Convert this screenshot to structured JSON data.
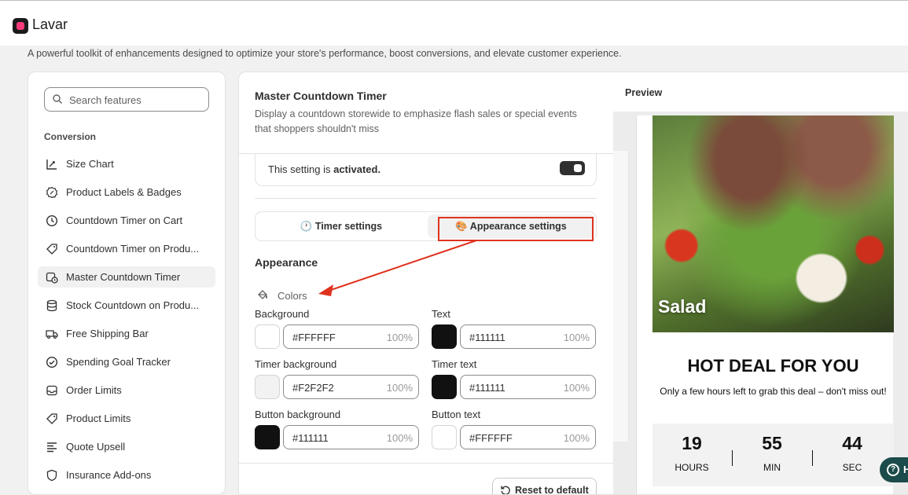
{
  "app": {
    "title": "Lavar",
    "tagline": "A powerful toolkit of enhancements designed to optimize your store's performance, boost conversions, and elevate customer experience."
  },
  "sidebar": {
    "search_placeholder": "Search features",
    "section": "Conversion",
    "items": [
      {
        "label": "Size Chart",
        "icon": "ruler-icon"
      },
      {
        "label": "Product Labels & Badges",
        "icon": "badge-icon"
      },
      {
        "label": "Countdown Timer on Cart",
        "icon": "clock-icon"
      },
      {
        "label": "Countdown Timer on Produ...",
        "icon": "tag-clock-icon"
      },
      {
        "label": "Master Countdown Timer",
        "icon": "calendar-clock-icon",
        "active": true
      },
      {
        "label": "Stock Countdown on Produ...",
        "icon": "database-icon"
      },
      {
        "label": "Free Shipping Bar",
        "icon": "truck-icon"
      },
      {
        "label": "Spending Goal Tracker",
        "icon": "check-circle-icon"
      },
      {
        "label": "Order Limits",
        "icon": "inbox-icon"
      },
      {
        "label": "Product Limits",
        "icon": "tag-icon"
      },
      {
        "label": "Quote Upsell",
        "icon": "list-icon"
      },
      {
        "label": "Insurance Add-ons",
        "icon": "shield-icon"
      }
    ]
  },
  "feature": {
    "title": "Master Countdown Timer",
    "description": "Display a countdown storewide to emphasize flash sales or special events that shoppers shouldn't miss",
    "activation_prefix": "This setting is ",
    "activation_state": "activated.",
    "tabs": [
      {
        "label": "🕐 Timer settings"
      },
      {
        "label": "🎨 Appearance settings",
        "selected": true
      }
    ],
    "appearance_heading": "Appearance",
    "colors_heading": "Colors",
    "colors": [
      {
        "label": "Background",
        "hex": "#FFFFFF",
        "opacity": "100%",
        "swatch": "#ffffff"
      },
      {
        "label": "Text",
        "hex": "#111111",
        "opacity": "100%",
        "swatch": "#111111"
      },
      {
        "label": "Timer background",
        "hex": "#F2F2F2",
        "opacity": "100%",
        "swatch": "#f2f2f2"
      },
      {
        "label": "Timer text",
        "hex": "#111111",
        "opacity": "100%",
        "swatch": "#111111"
      },
      {
        "label": "Button background",
        "hex": "#111111",
        "opacity": "100%",
        "swatch": "#111111"
      },
      {
        "label": "Button text",
        "hex": "#FFFFFF",
        "opacity": "100%",
        "swatch": "#ffffff"
      }
    ],
    "reset_label": "Reset to default"
  },
  "preview": {
    "heading": "Preview",
    "image_caption": "Salad",
    "deal_title": "HOT DEAL FOR YOU",
    "deal_subtitle": "Only a few hours left to grab this deal – don't miss out!",
    "timer": [
      {
        "value": "19",
        "unit": "HOURS"
      },
      {
        "value": "55",
        "unit": "MIN"
      },
      {
        "value": "44",
        "unit": "SEC"
      }
    ]
  },
  "help": {
    "label": "H"
  },
  "annotation_color": "#e0331f"
}
